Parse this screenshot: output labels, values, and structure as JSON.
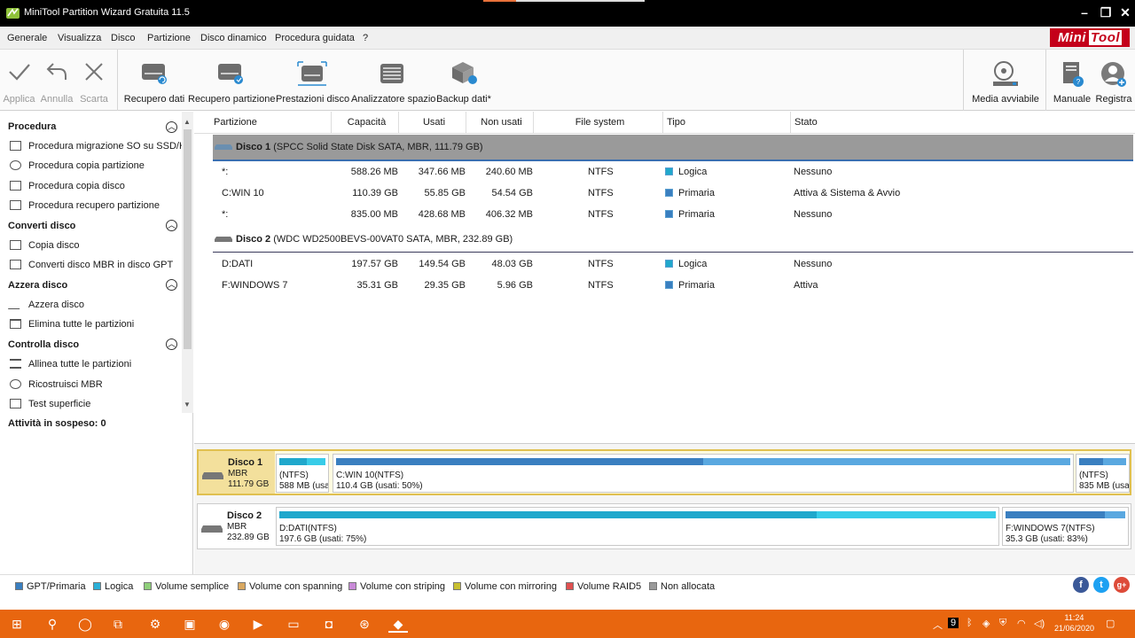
{
  "window": {
    "title": "MiniTool Partition Wizard Gratuita 11.5"
  },
  "menu": [
    "Generale",
    "Visualizza",
    "Disco",
    "Partizione",
    "Disco dinamico",
    "Procedura guidata",
    "?"
  ],
  "brand": {
    "mini": "Mini",
    "tool": "Tool"
  },
  "toolbar": {
    "apply": "Applica",
    "undo": "Annulla",
    "discard": "Scarta",
    "data_recovery": "Recupero dati",
    "partition_recovery": "Recupero partizione",
    "disk_benchmark": "Prestazioni disco",
    "space_analyzer": "Analizzatore spazio",
    "backup": "Backup dati*",
    "bootable_media": "Media avviabile",
    "manual": "Manuale",
    "register": "Registra"
  },
  "sidebar": {
    "sections": [
      {
        "title": "Procedura",
        "items": [
          "Procedura migrazione SO su SSD/HD",
          "Procedura copia partizione",
          "Procedura copia disco",
          "Procedura recupero partizione"
        ]
      },
      {
        "title": "Converti disco",
        "items": [
          "Copia disco",
          "Converti disco MBR in disco GPT"
        ]
      },
      {
        "title": "Azzera disco",
        "items": [
          "Azzera disco",
          "Elimina tutte le partizioni"
        ]
      },
      {
        "title": "Controlla disco",
        "items": [
          "Allinea tutte le partizioni",
          "Ricostruisci MBR",
          "Test superficie"
        ]
      }
    ],
    "pending": "Attività in sospeso: 0"
  },
  "table": {
    "headers": [
      "Partizione",
      "Capacità",
      "Usati",
      "Non usati",
      "File system",
      "Tipo",
      "Stato"
    ],
    "disks": [
      {
        "name": "Disco 1",
        "desc": "(SPCC Solid State Disk SATA, MBR, 111.79 GB)",
        "rows": [
          [
            "*:",
            "588.26 MB",
            "347.66 MB",
            "240.60 MB",
            "NTFS",
            "Logica",
            "Nessuno"
          ],
          [
            "C:WIN 10",
            "110.39 GB",
            "55.85 GB",
            "54.54 GB",
            "NTFS",
            "Primaria",
            "Attiva & Sistema & Avvio"
          ],
          [
            "*:",
            "835.00 MB",
            "428.68 MB",
            "406.32 MB",
            "NTFS",
            "Primaria",
            "Nessuno"
          ]
        ]
      },
      {
        "name": "Disco 2",
        "desc": "(WDC WD2500BEVS-00VAT0 SATA, MBR, 232.89 GB)",
        "rows": [
          [
            "D:DATI",
            "197.57 GB",
            "149.54 GB",
            "48.03 GB",
            "NTFS",
            "Logica",
            "Nessuno"
          ],
          [
            "F:WINDOWS 7",
            "35.31 GB",
            "29.35 GB",
            "5.96 GB",
            "NTFS",
            "Primaria",
            "Attiva"
          ]
        ]
      }
    ]
  },
  "diskmap": [
    {
      "name": "Disco 1",
      "type": "MBR",
      "size": "111.79 GB",
      "parts": [
        {
          "l1": "(NTFS)",
          "l2": "588 MB (usa",
          "used": 0.59
        },
        {
          "l1": "C:WIN 10(NTFS)",
          "l2": "110.4 GB (usati: 50%)",
          "used": 0.5
        },
        {
          "l1": "(NTFS)",
          "l2": "835 MB (usa",
          "used": 0.51
        }
      ]
    },
    {
      "name": "Disco 2",
      "type": "MBR",
      "size": "232.89 GB",
      "parts": [
        {
          "l1": "D:DATI(NTFS)",
          "l2": "197.6 GB (usati: 75%)",
          "used": 0.75
        },
        {
          "l1": "F:WINDOWS 7(NTFS)",
          "l2": "35.3 GB (usati: 83%)",
          "used": 0.83
        }
      ]
    }
  ],
  "legend": [
    {
      "label": "GPT/Primaria",
      "color": "#3a7fc0"
    },
    {
      "label": "Logica",
      "color": "#2bb0d8"
    },
    {
      "label": "Volume semplice",
      "color": "#8fcf7a"
    },
    {
      "label": "Volume con spanning",
      "color": "#d9a860"
    },
    {
      "label": "Volume con striping",
      "color": "#c98ad8"
    },
    {
      "label": "Volume con mirroring",
      "color": "#c8c030"
    },
    {
      "label": "Volume RAID5",
      "color": "#e05050"
    },
    {
      "label": "Non allocata",
      "color": "#9a9a9a"
    }
  ],
  "colors": {
    "primary": "#3a7fc0",
    "primary_light": "#5aa8e0",
    "logical": "#20a8cc",
    "logical_light": "#38cce8",
    "taskbar": "#e8660f"
  },
  "taskbar": {
    "time": "11:24",
    "date": "21/06/2020",
    "badge": "9"
  }
}
